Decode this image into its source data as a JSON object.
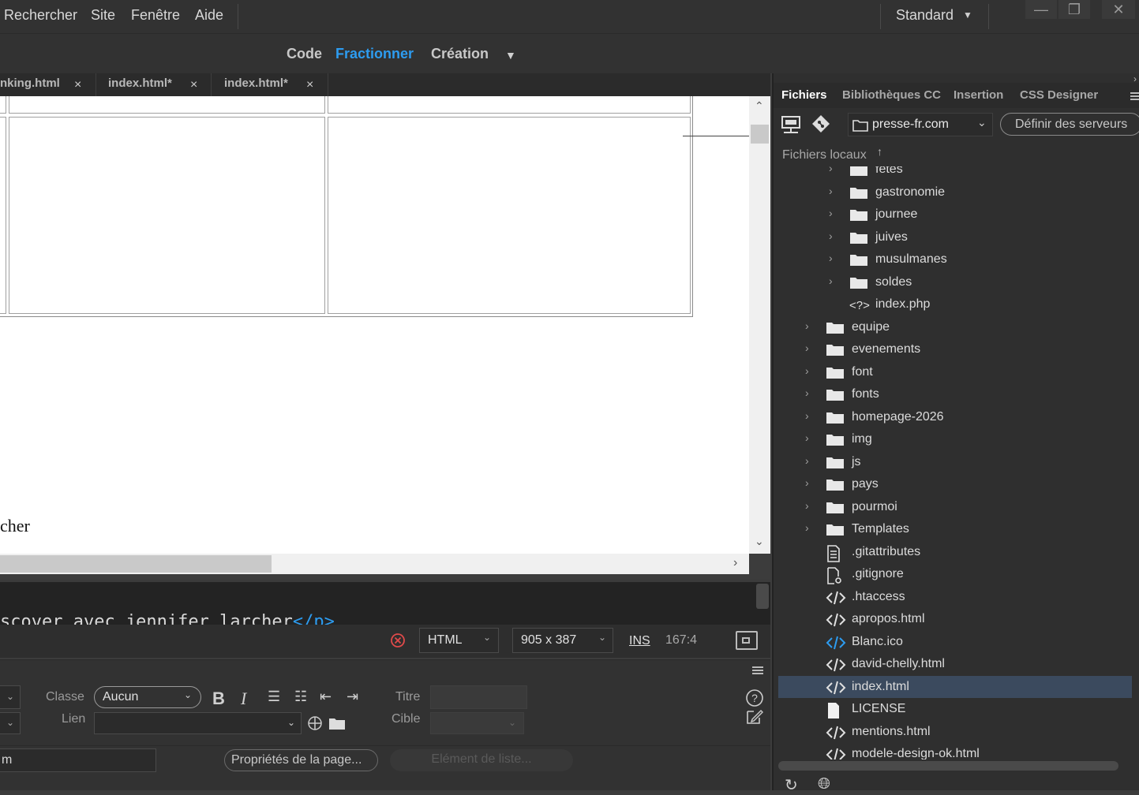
{
  "menubar": {
    "items": [
      "Rechercher",
      "Site",
      "Fenêtre",
      "Aide"
    ],
    "workspace": "Standard"
  },
  "viewbar": {
    "code": "Code",
    "split": "Fractionner",
    "design": "Création"
  },
  "doc_tabs": [
    {
      "label": "nking.html",
      "close": "×"
    },
    {
      "label": "index.html*",
      "close": "×"
    },
    {
      "label": "index.html*",
      "close": "×"
    }
  ],
  "design_view": {
    "text_fragment": "cher"
  },
  "code_view": {
    "line_text": "scover avec jennifer larcher",
    "line_tag": "</p>"
  },
  "statusbar": {
    "doc_type": "HTML",
    "window_size": "905 x 387",
    "insert_mode": "INS",
    "cursor_pos": "167:4"
  },
  "properties": {
    "class_label": "Classe",
    "class_value": "Aucun",
    "link_label": "Lien",
    "title_label": "Titre",
    "target_label": "Cible",
    "bold": "B",
    "italic": "I",
    "left_field_value": "m",
    "page_props_button": "Propriétés de la page...",
    "list_item_button": "Elément de liste..."
  },
  "right_panel": {
    "tabs": [
      "Fichiers",
      "Bibliothèques CC",
      "Insertion",
      "CSS Designer"
    ],
    "site_name": "presse-fr.com",
    "define_servers": "Définir des serveurs",
    "local_files": "Fichiers locaux",
    "tree": [
      {
        "label": "fetes",
        "type": "folder",
        "level": 2
      },
      {
        "label": "gastronomie",
        "type": "folder",
        "level": 2
      },
      {
        "label": "journee",
        "type": "folder",
        "level": 2
      },
      {
        "label": "juives",
        "type": "folder",
        "level": 2
      },
      {
        "label": "musulmanes",
        "type": "folder",
        "level": 2
      },
      {
        "label": "soldes",
        "type": "folder",
        "level": 2
      },
      {
        "label": "index.php",
        "type": "php",
        "level": 2
      },
      {
        "label": "equipe",
        "type": "folder",
        "level": 1
      },
      {
        "label": "evenements",
        "type": "folder",
        "level": 1
      },
      {
        "label": "font",
        "type": "folder",
        "level": 1
      },
      {
        "label": "fonts",
        "type": "folder",
        "level": 1
      },
      {
        "label": "homepage-2026",
        "type": "folder",
        "level": 1
      },
      {
        "label": "img",
        "type": "folder",
        "level": 1
      },
      {
        "label": "js",
        "type": "folder",
        "level": 1
      },
      {
        "label": "pays",
        "type": "folder",
        "level": 1
      },
      {
        "label": "pourmoi",
        "type": "folder",
        "level": 1
      },
      {
        "label": "Templates",
        "type": "folder",
        "level": 1
      },
      {
        "label": ".gitattributes",
        "type": "doc",
        "level": 1
      },
      {
        "label": ".gitignore",
        "type": "docgear",
        "level": 1
      },
      {
        "label": ".htaccess",
        "type": "code",
        "level": 1
      },
      {
        "label": "apropos.html",
        "type": "code",
        "level": 1
      },
      {
        "label": "Blanc.ico",
        "type": "codeblue",
        "level": 1
      },
      {
        "label": "david-chelly.html",
        "type": "code",
        "level": 1
      },
      {
        "label": "index.html",
        "type": "code",
        "level": 1,
        "selected": true
      },
      {
        "label": "LICENSE",
        "type": "blank",
        "level": 1
      },
      {
        "label": "mentions.html",
        "type": "code",
        "level": 1
      },
      {
        "label": "modele-design-ok.html",
        "type": "code",
        "level": 1
      }
    ]
  },
  "colors": {
    "accent": "#2d9cf0",
    "selected_row": "#3b4a5e",
    "error": "#e04a4a"
  }
}
